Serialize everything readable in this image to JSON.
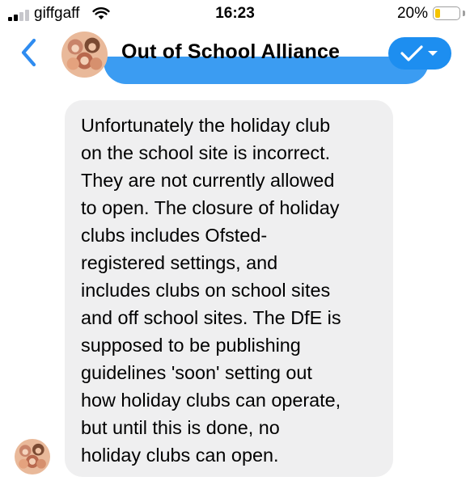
{
  "status_bar": {
    "carrier": "giffgaff",
    "time": "16:23",
    "battery_percent": "20%",
    "battery_level": 0.2,
    "signal_bars_active": 2,
    "signal_bars_total": 4,
    "wifi_icon": "wifi-icon",
    "battery_color": "#f5c400"
  },
  "header": {
    "back_icon": "chevron-left-icon",
    "title": "Out of School Alliance",
    "action_icon": "checkmark-dropdown-icon",
    "accent_color": "#1d8ef0"
  },
  "message": {
    "lines": [
      "Unfortunately the holiday club",
      "on the school site is incorrect.",
      "They are not currently allowed",
      "to open. The closure of holiday",
      "clubs includes Ofsted-",
      "registered settings, and",
      "includes clubs on school sites",
      "and off school sites. The DfE is",
      "supposed to be publishing",
      "guidelines 'soon' setting out",
      "how holiday clubs can operate,",
      "but until this is done, no",
      "holiday clubs can open."
    ],
    "bubble_color": "#efeff0"
  }
}
